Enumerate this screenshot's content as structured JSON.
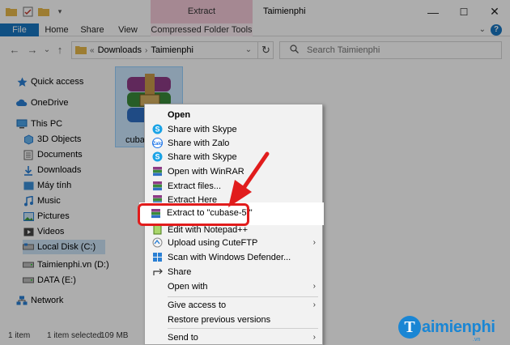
{
  "window": {
    "title": "Taimienphi",
    "context_tab_header": "Extract",
    "minimize": "—",
    "maximize": "☐",
    "close": "✕"
  },
  "ribbon": {
    "tabs": [
      "File",
      "Home",
      "Share",
      "View",
      "Compressed Folder Tools"
    ],
    "collapse": "⌄",
    "help": "?"
  },
  "address": {
    "back": "←",
    "forward": "→",
    "recent": "⌄",
    "up": "↑",
    "prefix": "«",
    "crumbs": [
      "Downloads",
      "Taimienphi"
    ],
    "separator": "›",
    "dropdown": "⌄",
    "refresh": "↻",
    "search_placeholder": "Search Taimienphi"
  },
  "nav": [
    {
      "label": "Quick access",
      "icon": "star-icon"
    },
    {
      "label": "OneDrive",
      "icon": "cloud-icon"
    },
    {
      "label": "This PC",
      "icon": "computer-icon"
    },
    {
      "label": "3D Objects",
      "icon": "cube-icon"
    },
    {
      "label": "Documents",
      "icon": "document-icon"
    },
    {
      "label": "Downloads",
      "icon": "download-icon"
    },
    {
      "label": "Máy tính",
      "icon": "desktop-icon"
    },
    {
      "label": "Music",
      "icon": "music-icon"
    },
    {
      "label": "Pictures",
      "icon": "picture-icon"
    },
    {
      "label": "Videos",
      "icon": "video-icon"
    },
    {
      "label": "Local Disk (C:)",
      "icon": "drive-icon"
    },
    {
      "label": "Taimienphi.vn (D:)",
      "icon": "drive-icon"
    },
    {
      "label": "DATA (E:)",
      "icon": "drive-icon"
    },
    {
      "label": "Network",
      "icon": "network-icon"
    }
  ],
  "file": {
    "label": "cuba"
  },
  "status": {
    "count": "1 item",
    "selected": "1 item selected",
    "size": "109 MB"
  },
  "context_menu": [
    {
      "label": "Open",
      "icon": "",
      "bold": true
    },
    {
      "label": "Share with Skype",
      "icon": "skype-icon"
    },
    {
      "label": "Share with Zalo",
      "icon": "zalo-icon"
    },
    {
      "label": "Share with Skype",
      "icon": "skype-icon"
    },
    {
      "label": "Open with WinRAR",
      "icon": "winrar-icon"
    },
    {
      "label": "Extract files...",
      "icon": "winrar-icon"
    },
    {
      "label": "Extract Here",
      "icon": "winrar-icon"
    },
    {
      "label": "Extract to \"cubase-5\\\"",
      "icon": "winrar-icon",
      "highlighted": true
    },
    {
      "label": "Edit with Notepad++",
      "icon": "notepad-icon"
    },
    {
      "label": "Upload using CuteFTP",
      "icon": "cuteftp-icon",
      "submenu": true
    },
    {
      "label": "Scan with Windows Defender...",
      "icon": "defender-icon"
    },
    {
      "label": "Share",
      "icon": "share-icon"
    },
    {
      "label": "Open with",
      "icon": "",
      "submenu": true
    },
    {
      "label": "Give access to",
      "icon": "",
      "submenu": true
    },
    {
      "label": "Restore previous versions",
      "icon": ""
    },
    {
      "label": "Send to",
      "icon": "",
      "submenu": true
    }
  ],
  "brand": {
    "letter": "T",
    "text": "aimienphi",
    "sub": ".vn"
  },
  "colors": {
    "accent": "#1976c2",
    "highlight_border": "#e11c1c",
    "context_tab": "#f3c9d8"
  }
}
